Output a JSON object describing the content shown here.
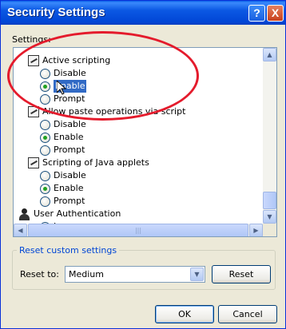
{
  "window": {
    "title": "Security Settings",
    "help_label": "?",
    "close_label": "X"
  },
  "settings_label": "Settings:",
  "tree": [
    {
      "type": "category",
      "label": "Active scripting"
    },
    {
      "type": "option",
      "label": "Disable",
      "checked": false
    },
    {
      "type": "option",
      "label": "Enable",
      "checked": true,
      "selected": true
    },
    {
      "type": "option",
      "label": "Prompt",
      "checked": false
    },
    {
      "type": "category",
      "label": "Allow paste operations via script"
    },
    {
      "type": "option",
      "label": "Disable",
      "checked": false
    },
    {
      "type": "option",
      "label": "Enable",
      "checked": true
    },
    {
      "type": "option",
      "label": "Prompt",
      "checked": false
    },
    {
      "type": "category",
      "label": "Scripting of Java applets"
    },
    {
      "type": "option",
      "label": "Disable",
      "checked": false
    },
    {
      "type": "option",
      "label": "Enable",
      "checked": true
    },
    {
      "type": "option",
      "label": "Prompt",
      "checked": false
    },
    {
      "type": "user",
      "label": "User Authentication"
    },
    {
      "type": "option",
      "label": "Logon",
      "checked": false
    }
  ],
  "reset_group": {
    "title": "Reset custom settings",
    "reset_to_label": "Reset to:",
    "selected_value": "Medium",
    "reset_button": "Reset"
  },
  "buttons": {
    "ok": "OK",
    "cancel": "Cancel"
  },
  "colors": {
    "titlebar": "#0054e3",
    "selection": "#316ac5",
    "annotation": "#e41b2c",
    "group_title": "#0046d5"
  }
}
